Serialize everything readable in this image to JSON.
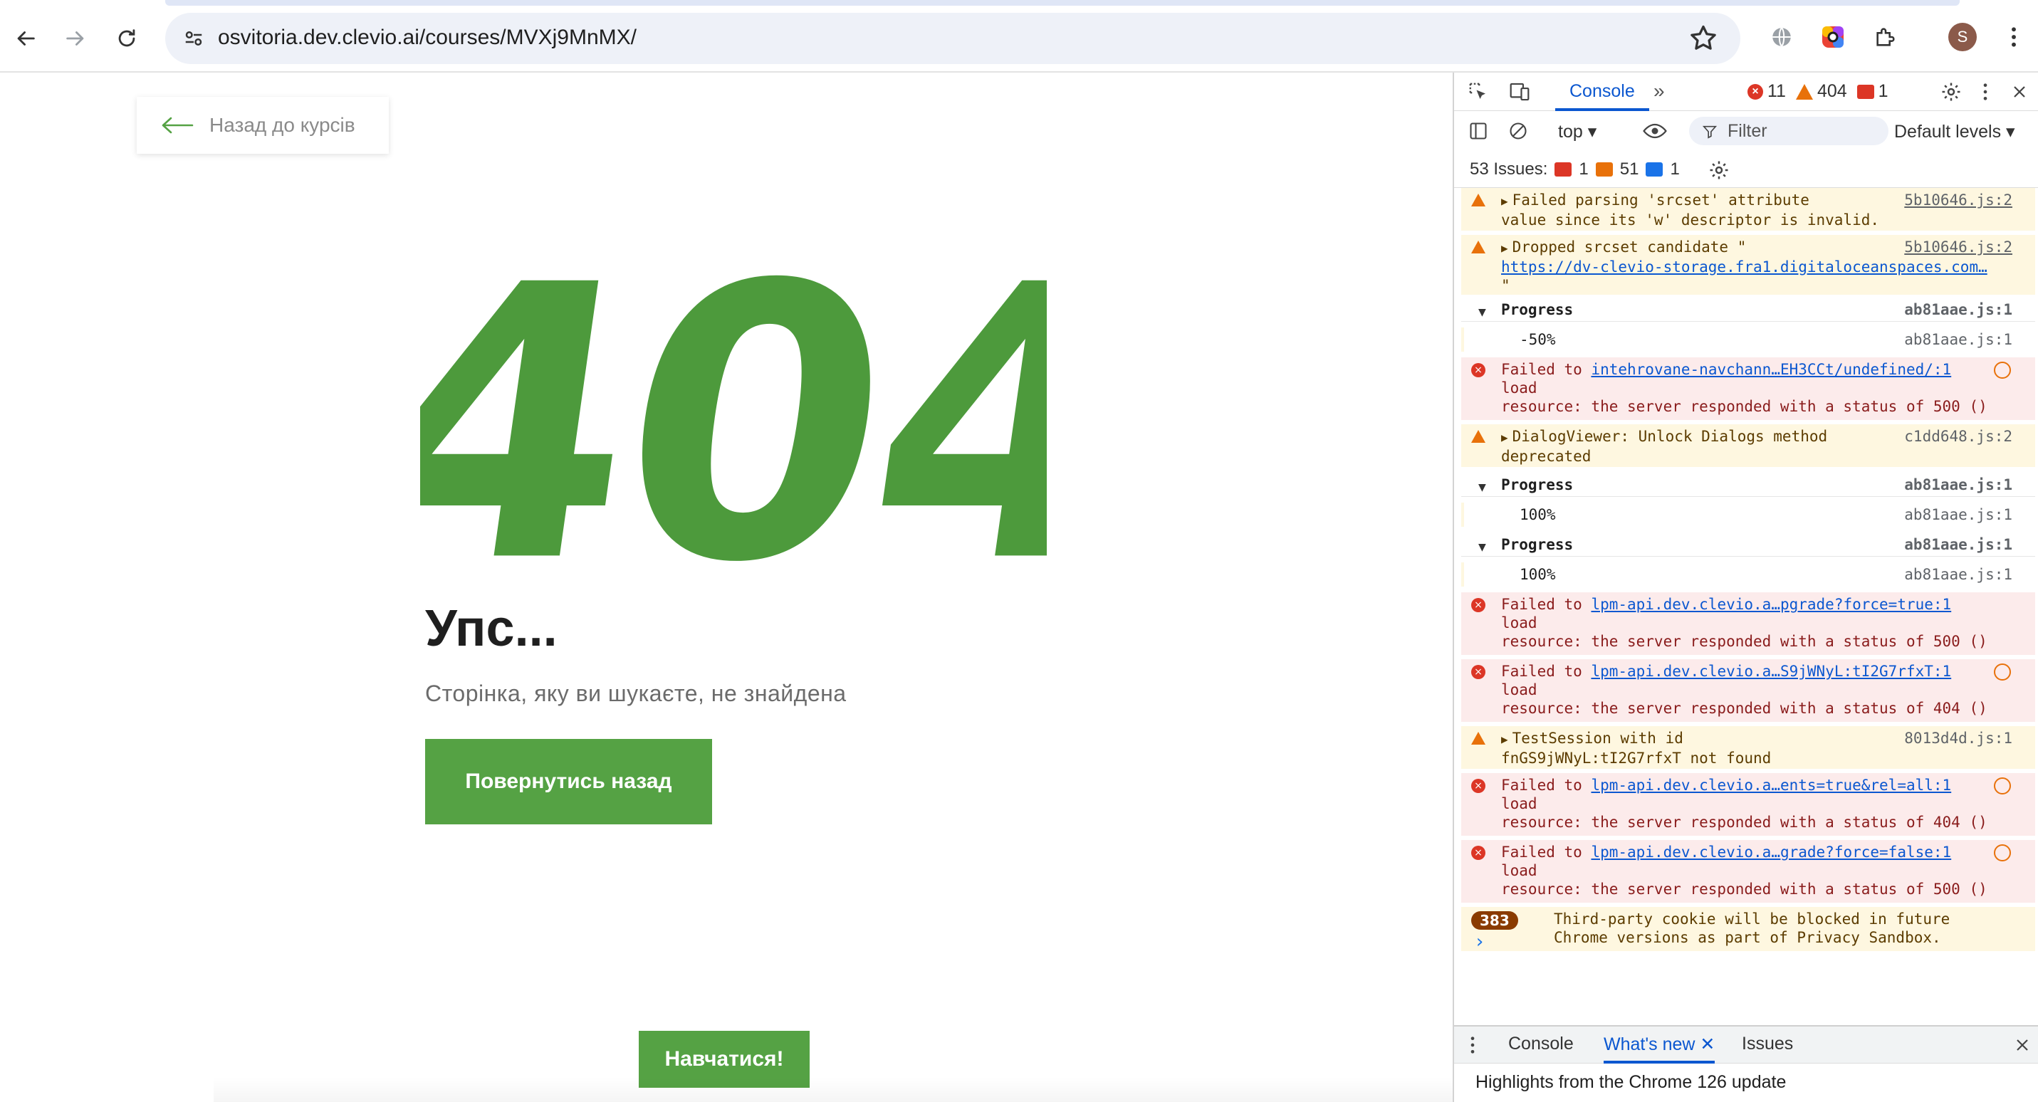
{
  "browser": {
    "url": "osvitoria.dev.clevio.ai/courses/MVXj9MnMX/",
    "avatar_letter": "S"
  },
  "page": {
    "back_link": "Назад до курсів",
    "error_code": "404",
    "title": "Упс...",
    "subtitle": "Сторінка, яку ви шукаєте, не знайдена",
    "back_button": "Повернутись назад",
    "learn_button": "Навчатися!",
    "accent_color": "#55a244"
  },
  "devtools": {
    "active_tab": "Console",
    "more_tabs": "»",
    "error_count": "11",
    "warning_count": "404",
    "message_count": "1",
    "context": "top",
    "filter_placeholder": "Filter",
    "levels": "Default levels",
    "issues": {
      "label": "53 Issues:",
      "errors": "1",
      "warnings": "51",
      "info": "1"
    },
    "messages": [
      {
        "type": "warn",
        "text1": "Failed parsing 'srcset' attribute",
        "text2": "value since its 'w' descriptor is invalid.",
        "source": "5b10646.js:2"
      },
      {
        "type": "warn",
        "text1": "Dropped srcset candidate \"",
        "link": "https://dv-clevio-storage.fra1.digitaloceanspaces.com…",
        "text3": "\"",
        "source": "5b10646.js:2"
      },
      {
        "type": "group",
        "text1": "Progress",
        "source": "ab81aae.js:1"
      },
      {
        "type": "value",
        "text1": "-50%",
        "source": "ab81aae.js:1"
      },
      {
        "type": "err",
        "text1": "Failed to",
        "link": "intehrovane-navchann…EH3CCt/undefined/:1",
        "text2": "load",
        "text3": "resource: the server responded with a status of 500 ()"
      },
      {
        "type": "warn",
        "text1": "DialogViewer: Unlock Dialogs method",
        "text2": "deprecated",
        "source": "c1dd648.js:2"
      },
      {
        "type": "group",
        "text1": "Progress",
        "source": "ab81aae.js:1"
      },
      {
        "type": "value",
        "text1": "100%",
        "source": "ab81aae.js:1"
      },
      {
        "type": "group",
        "text1": "Progress",
        "source": "ab81aae.js:1"
      },
      {
        "type": "value",
        "text1": "100%",
        "source": "ab81aae.js:1"
      },
      {
        "type": "err",
        "text1": "Failed to",
        "link": "lpm-api.dev.clevio.a…pgrade?force=true:1",
        "text2": "load",
        "text3": "resource: the server responded with a status of 500 ()"
      },
      {
        "type": "err",
        "text1": "Failed to",
        "link": "lpm-api.dev.clevio.a…S9jWNyL:tI2G7rfxT:1",
        "text2": "load",
        "text3": "resource: the server responded with a status of 404 ()"
      },
      {
        "type": "warn",
        "text1": "TestSession with id",
        "text2": "fnGS9jWNyL:tI2G7rfxT not found",
        "source": "8013d4d.js:1"
      },
      {
        "type": "err",
        "text1": "Failed to",
        "link": "lpm-api.dev.clevio.a…ents=true&rel=all:1",
        "text2": "load",
        "text3": "resource: the server responded with a status of 404 ()"
      },
      {
        "type": "err",
        "text1": "Failed to",
        "link": "lpm-api.dev.clevio.a…grade?force=false:1",
        "text2": "load",
        "text3": "resource: the server responded with a status of 500 ()"
      },
      {
        "type": "badge",
        "badge": "383",
        "text1": "Third-party cookie will be blocked in future",
        "text2": "Chrome versions as part of Privacy Sandbox."
      }
    ],
    "prompt": "›",
    "drawer": {
      "tab_console": "Console",
      "tab_whats_new": "What's new",
      "tab_issues": "Issues",
      "body": "Highlights from the Chrome 126 update"
    }
  }
}
